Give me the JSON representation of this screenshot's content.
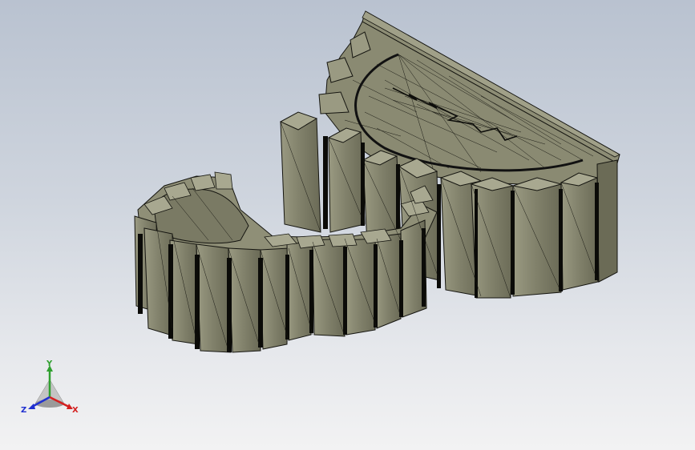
{
  "viewport": {
    "background_top": "#b9c2d0",
    "background_bottom": "#f2f2f3"
  },
  "model": {
    "face_color": "#8a8a72",
    "face_dark": "#6b6b56",
    "face_light": "#a3a38a",
    "edge_color": "#151510"
  },
  "triad": {
    "x_label": "X",
    "y_label": "Y",
    "z_label": "Z",
    "x_color": "#d42020",
    "y_color": "#2fa02f",
    "z_color": "#2030d0"
  }
}
